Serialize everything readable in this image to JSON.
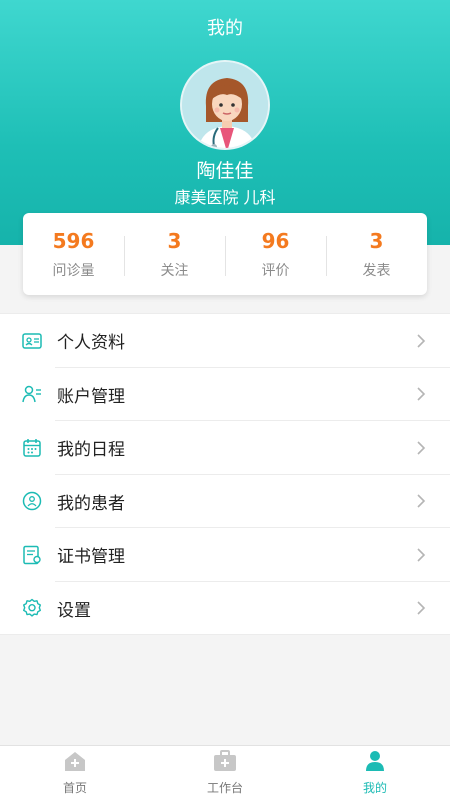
{
  "header": {
    "title": "我的"
  },
  "profile": {
    "name": "陶佳佳",
    "hospital": "康美医院 儿科"
  },
  "stats": [
    {
      "value": "596",
      "label": "问诊量"
    },
    {
      "value": "3",
      "label": "关注"
    },
    {
      "value": "96",
      "label": "评价"
    },
    {
      "value": "3",
      "label": "发表"
    }
  ],
  "menu": [
    {
      "label": "个人资料",
      "icon": "id-card-icon"
    },
    {
      "label": "账户管理",
      "icon": "user-list-icon"
    },
    {
      "label": "我的日程",
      "icon": "calendar-icon"
    },
    {
      "label": "我的患者",
      "icon": "patient-icon"
    },
    {
      "label": "证书管理",
      "icon": "certificate-icon"
    },
    {
      "label": "设置",
      "icon": "gear-icon"
    }
  ],
  "tabbar": [
    {
      "label": "首页",
      "icon": "home-icon",
      "active": false
    },
    {
      "label": "工作台",
      "icon": "medical-kit-icon",
      "active": false
    },
    {
      "label": "我的",
      "icon": "person-icon",
      "active": true
    }
  ],
  "colors": {
    "accent": "#1cbbb4",
    "stat_value": "#f47a1f"
  }
}
